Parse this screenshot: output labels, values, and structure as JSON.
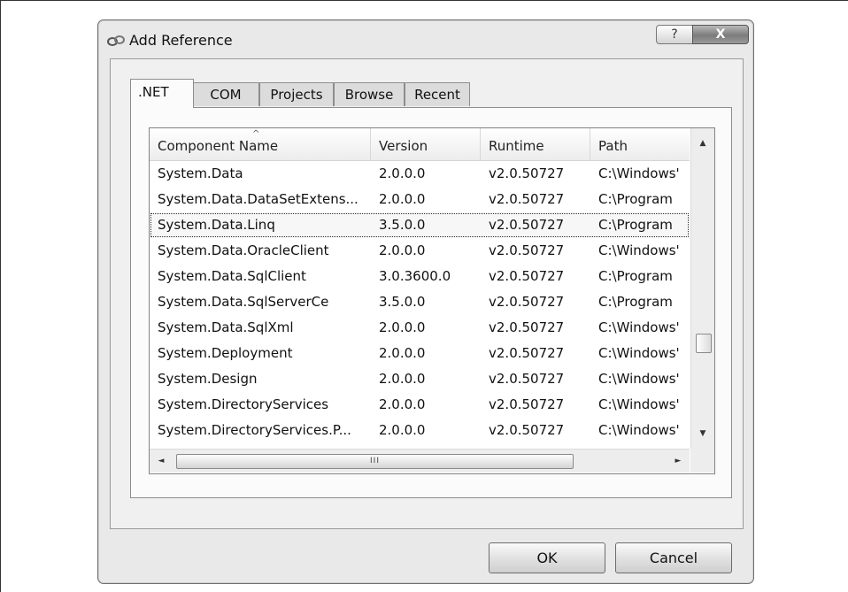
{
  "window": {
    "title": "Add Reference",
    "help_glyph": "?",
    "close_glyph": "X"
  },
  "tabs": [
    ".NET",
    "COM",
    "Projects",
    "Browse",
    "Recent"
  ],
  "active_tab": ".NET",
  "list": {
    "columns": [
      "Component Name",
      "Version",
      "Runtime",
      "Path"
    ],
    "sort_indicator": "^",
    "rows": [
      [
        "System.Data",
        "2.0.0.0",
        "v2.0.50727",
        "C:\\Windows'"
      ],
      [
        "System.Data.DataSetExtens...",
        "2.0.0.0",
        "v2.0.50727",
        "C:\\Program"
      ],
      [
        "System.Data.Linq",
        "3.5.0.0",
        "v2.0.50727",
        "C:\\Program"
      ],
      [
        "System.Data.OracleClient",
        "2.0.0.0",
        "v2.0.50727",
        "C:\\Windows'"
      ],
      [
        "System.Data.SqlClient",
        "3.0.3600.0",
        "v2.0.50727",
        "C:\\Program"
      ],
      [
        "System.Data.SqlServerCe",
        "3.5.0.0",
        "v2.0.50727",
        "C:\\Program"
      ],
      [
        "System.Data.SqlXml",
        "2.0.0.0",
        "v2.0.50727",
        "C:\\Windows'"
      ],
      [
        "System.Deployment",
        "2.0.0.0",
        "v2.0.50727",
        "C:\\Windows'"
      ],
      [
        "System.Design",
        "2.0.0.0",
        "v2.0.50727",
        "C:\\Windows'"
      ],
      [
        "System.DirectoryServices",
        "2.0.0.0",
        "v2.0.50727",
        "C:\\Windows'"
      ],
      [
        "System.DirectoryServices.P...",
        "2.0.0.0",
        "v2.0.50727",
        "C:\\Windows'"
      ]
    ],
    "focused_row": "System.Data.Linq",
    "vscroll_up": "▲",
    "vscroll_down": "▼",
    "hscroll_left": "◄",
    "hscroll_right": "►",
    "hscroll_grip": "III"
  },
  "buttons": {
    "ok": "OK",
    "cancel": "Cancel"
  }
}
